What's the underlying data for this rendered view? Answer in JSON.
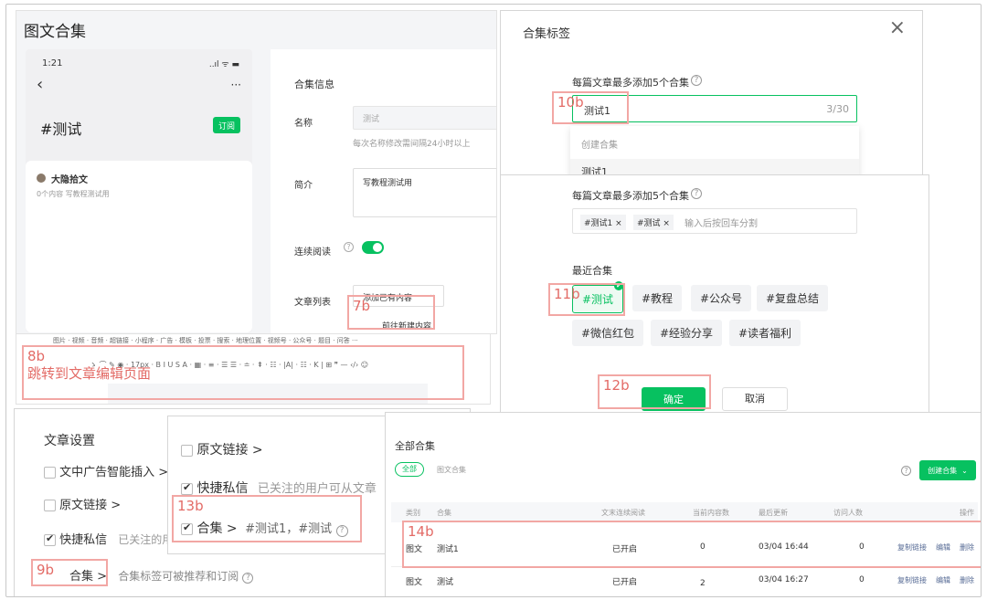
{
  "p1": {
    "title": "图文合集",
    "phone": {
      "time": "1:21",
      "signal": "..ıl ᯤ ▬",
      "back": "‹",
      "more": "···",
      "tag": "#测试",
      "subscribe": "订阅",
      "author": "大隐拾文",
      "author_sub": "0个内容  写教程测试用"
    },
    "form": {
      "section": "合集信息",
      "name_label": "名称",
      "name_value": "测试",
      "name_hint": "每次名称修改需间隔24小时以上",
      "intro_label": "简介",
      "intro_value": "写教程测试用",
      "read_label": "连续阅读",
      "list_label": "文章列表",
      "list_button": "添加已有内容",
      "new_item": "前往新建内容"
    }
  },
  "p2": {
    "title": "合集标签",
    "hint": "每篇文章最多添加5个合集",
    "input_value": "测试1",
    "counter": "3/30",
    "drop_create": "创建合集",
    "drop_item": "测试1"
  },
  "p3": {
    "hint": "每篇文章最多添加5个合集",
    "chip1": "#测试1",
    "chip2": "#测试",
    "chip_x": "×",
    "input_placeholder": "输入后按回车分割",
    "recent_title": "最近合集",
    "tags": [
      "#测试",
      "#教程",
      "#公众号",
      "#复盘总结",
      "#微信红包",
      "#经验分享",
      "#读者福利"
    ],
    "confirm": "确定",
    "cancel": "取消"
  },
  "toolbar": {
    "text": "ゝ ⌒ ✎ ◉ · 17px · B I U S A · ▦ · ≡ · ☰ ☰ · ≐ · ⇞ · ☷ · |A| · ☷ · K | ⊞ ❞ — ‹/› ☺",
    "top_text": "图片 · 视频 · 音频 · 超链接 · 小程序 · 广告 · 模板 · 投票 · 搜索 · 地理位置 · 视频号 · 公众号 · 题目 · 问答 ···",
    "jump_text": "跳转到文章编辑页面"
  },
  "p4": {
    "title": "文章设置",
    "ad": "文中广告智能插入",
    "orig": "原文链接",
    "dm": "快捷私信",
    "dm_hint": "已关注的用户可从文",
    "coll": "合集",
    "coll_hint": "合集标签可被推荐和订阅",
    "arrow": ">"
  },
  "p5": {
    "orig": "原文链接",
    "dm": "快捷私信",
    "dm_hint": "已关注的用户可从文章",
    "coll": "合集",
    "coll_value": "#测试1，#测试",
    "arrow": ">"
  },
  "p6": {
    "title": "全部合集",
    "filter_all": "全部",
    "filter_pic": "图文合集",
    "create": "创建合集",
    "headers": [
      "类别",
      "合集",
      "文末连续阅读",
      "当前内容数",
      "最后更新",
      "访问人数",
      "操作"
    ],
    "rows": [
      {
        "type": "图文",
        "name": "测试1",
        "read": "已开启",
        "count": "0",
        "updated": "03/04 16:44",
        "visits": "0",
        "a1": "复制链接",
        "a2": "编辑",
        "a3": "删除"
      },
      {
        "type": "图文",
        "name": "测试",
        "read": "已开启",
        "count": "2",
        "updated": "03/04 16:27",
        "visits": "0",
        "a1": "复制链接",
        "a2": "编辑",
        "a3": "删除"
      }
    ]
  },
  "labels": {
    "a7b": "7b",
    "a8b": "8b",
    "a9b": "9b",
    "a10b": "10b",
    "a11b": "11b",
    "a12b": "12b",
    "a13b": "13b",
    "a14b": "14b"
  },
  "colors": {
    "green": "#07c160",
    "annotation": "#f2a7a4",
    "link": "#576b95"
  }
}
